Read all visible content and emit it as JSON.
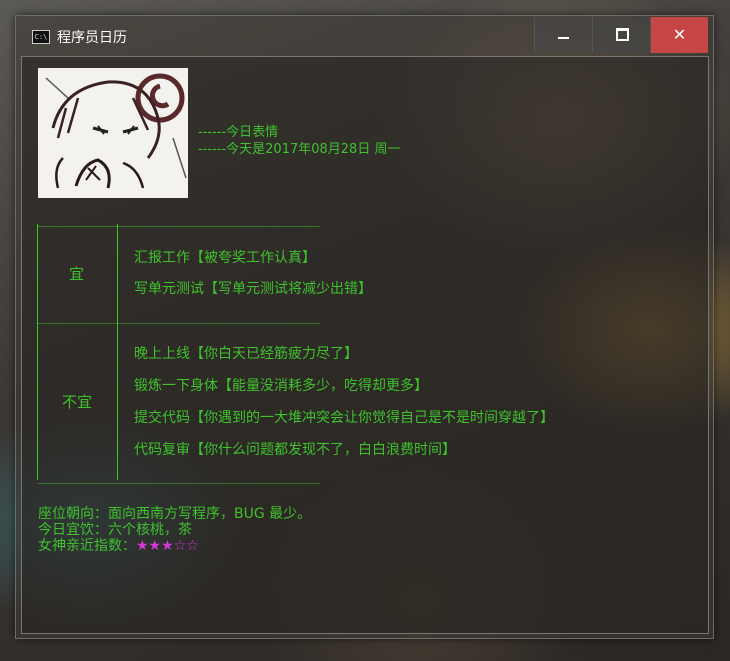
{
  "window": {
    "title": "程序员日历",
    "app_icon_text": "C:\\",
    "controls": {
      "minimize": "minimize",
      "maximize": "maximize",
      "close": "✕"
    }
  },
  "header": {
    "mood_line": "------今日表情",
    "date_line": "------今天是2017年08月28日 周一"
  },
  "divider": "_______________________________________",
  "suitable": {
    "label": "宜",
    "items": [
      "汇报工作【被夸奖工作认真】",
      "写单元测试【写单元测试将减少出错】"
    ]
  },
  "unsuitable": {
    "label": "不宜",
    "items": [
      "晚上上线【你白天已经筋疲力尽了】",
      "锻炼一下身体【能量没消耗多少，吃得却更多】",
      "提交代码【你遇到的一大堆冲突会让你觉得自己是不是时间穿越了】",
      "代码复审【你什么问题都发现不了，白白浪费时间】"
    ]
  },
  "footer": {
    "seat": "座位朝向：面向西南方写程序，BUG 最少。",
    "drink": "今日宜饮：六个核桃，茶",
    "goddess_label": "女神亲近指数：",
    "goddess_stars": "★★★☆☆"
  },
  "colors": {
    "text": "#3fc22d",
    "stars": "#d63ad6",
    "close": "#c64545"
  }
}
